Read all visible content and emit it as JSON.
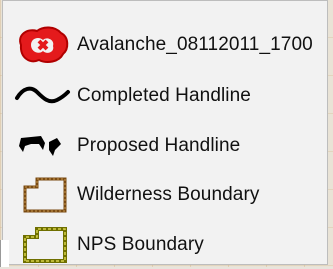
{
  "legend": {
    "items": [
      {
        "label": "Avalanche_08112011_1700",
        "icon": "fire-perimeter-icon",
        "color": "#e41a1c"
      },
      {
        "label": "Completed Handline",
        "icon": "completed-handline-icon",
        "color": "#000000"
      },
      {
        "label": "Proposed Handline",
        "icon": "proposed-handline-icon",
        "color": "#000000"
      },
      {
        "label": "Wilderness Boundary",
        "icon": "wilderness-boundary-icon",
        "color": "#7a4a12"
      },
      {
        "label": "NPS Boundary",
        "icon": "nps-boundary-icon",
        "color": "#8a8a12"
      }
    ]
  }
}
